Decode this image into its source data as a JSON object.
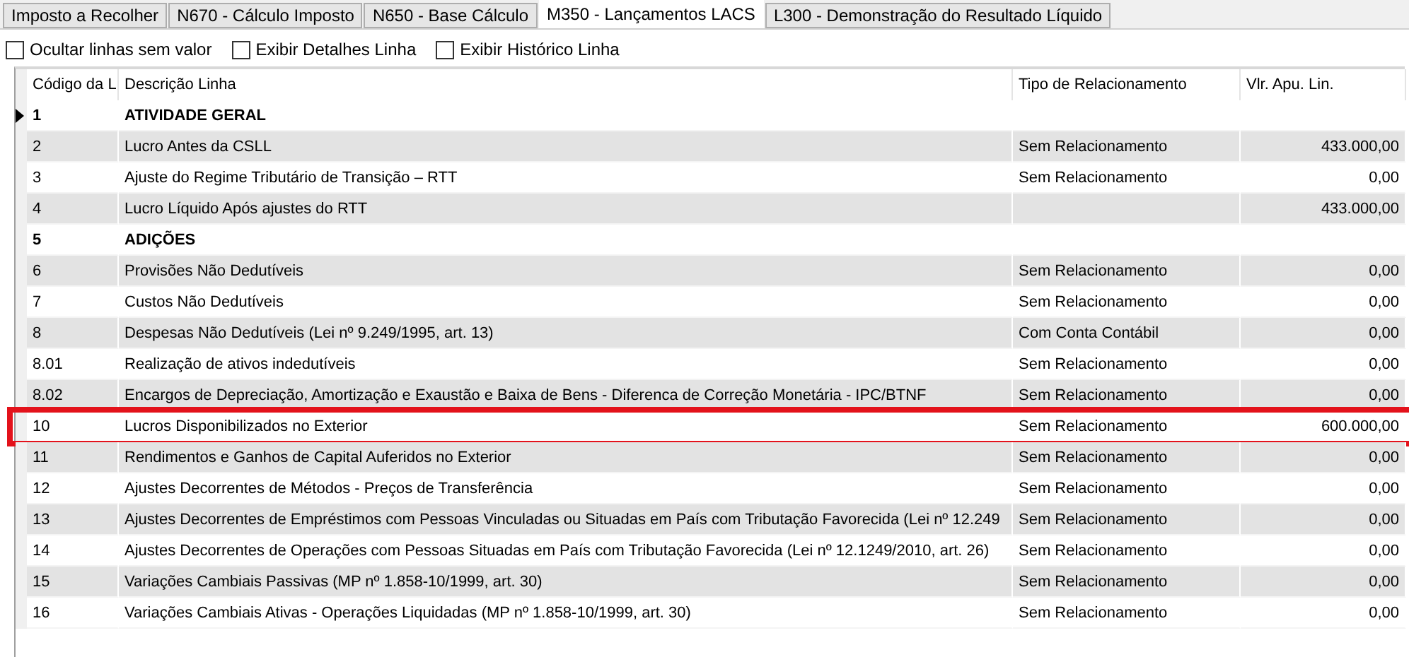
{
  "tabs": [
    {
      "label": "Imposto a Recolher",
      "selected": false
    },
    {
      "label": "N670 - Cálculo Imposto",
      "selected": false
    },
    {
      "label": "N650 - Base Cálculo",
      "selected": false
    },
    {
      "label": "M350 - Lançamentos LACS",
      "selected": true
    },
    {
      "label": "L300 - Demonstração do Resultado Líquido",
      "selected": false
    }
  ],
  "options": [
    {
      "label": "Ocultar linhas sem valor",
      "checked": false
    },
    {
      "label": "Exibir Detalhes Linha",
      "checked": false
    },
    {
      "label": "Exibir Histórico Linha",
      "checked": false
    }
  ],
  "table": {
    "columns": [
      "Código da L",
      "Descrição Linha",
      "Tipo de Relacionamento",
      "Vlr. Apu. Lin."
    ],
    "rows": [
      {
        "kind": "group",
        "current": true,
        "highlighted": false,
        "cells": [
          "1",
          "ATIVIDADE GERAL",
          "",
          ""
        ]
      },
      {
        "kind": "line",
        "current": false,
        "highlighted": false,
        "cells": [
          "2",
          "Lucro Antes da CSLL",
          "Sem Relacionamento",
          "433.000,00"
        ]
      },
      {
        "kind": "line",
        "current": false,
        "highlighted": false,
        "cells": [
          "3",
          "Ajuste do Regime Tributário de Transição – RTT",
          "Sem Relacionamento",
          "0,00"
        ]
      },
      {
        "kind": "line",
        "current": false,
        "highlighted": false,
        "cells": [
          "4",
          "Lucro Líquido Após ajustes do RTT",
          "",
          "433.000,00"
        ]
      },
      {
        "kind": "group",
        "current": false,
        "highlighted": false,
        "cells": [
          "5",
          "ADIÇÕES",
          "",
          ""
        ]
      },
      {
        "kind": "line",
        "current": false,
        "highlighted": false,
        "cells": [
          "6",
          "Provisões Não Dedutíveis",
          "Sem Relacionamento",
          "0,00"
        ]
      },
      {
        "kind": "line",
        "current": false,
        "highlighted": false,
        "cells": [
          "7",
          "Custos Não Dedutíveis",
          "Sem Relacionamento",
          "0,00"
        ]
      },
      {
        "kind": "line",
        "current": false,
        "highlighted": false,
        "cells": [
          "8",
          "Despesas Não Dedutíveis (Lei nº 9.249/1995, art. 13)",
          "Com Conta Contábil",
          "0,00"
        ]
      },
      {
        "kind": "line",
        "current": false,
        "highlighted": false,
        "cells": [
          "8.01",
          "Realização de ativos indedutíveis",
          "Sem Relacionamento",
          "0,00"
        ]
      },
      {
        "kind": "line",
        "current": false,
        "highlighted": false,
        "cells": [
          "8.02",
          "Encargos de Depreciação, Amortização e Exaustão e Baixa de Bens - Diferenca de Correção Monetária - IPC/BTNF",
          "Sem Relacionamento",
          "0,00"
        ]
      },
      {
        "kind": "line",
        "current": false,
        "highlighted": true,
        "cells": [
          "10",
          "Lucros Disponibilizados no Exterior",
          "Sem Relacionamento",
          "600.000,00"
        ]
      },
      {
        "kind": "line",
        "current": false,
        "highlighted": false,
        "cells": [
          "11",
          "Rendimentos e Ganhos de Capital Auferidos no Exterior",
          "Sem Relacionamento",
          "0,00"
        ]
      },
      {
        "kind": "line",
        "current": false,
        "highlighted": false,
        "cells": [
          "12",
          "Ajustes Decorrentes de Métodos - Preços de Transferência",
          "Sem Relacionamento",
          "0,00"
        ]
      },
      {
        "kind": "line",
        "current": false,
        "highlighted": false,
        "cells": [
          "13",
          "Ajustes Decorrentes de Empréstimos com Pessoas Vinculadas ou Situadas em País com Tributação Favorecida (Lei nº 12.249",
          "Sem Relacionamento",
          "0,00"
        ]
      },
      {
        "kind": "line",
        "current": false,
        "highlighted": false,
        "cells": [
          "14",
          "Ajustes Decorrentes de Operações com Pessoas Situadas em País com Tributação Favorecida (Lei nº 12.1249/2010, art. 26)",
          "Sem Relacionamento",
          "0,00"
        ]
      },
      {
        "kind": "line",
        "current": false,
        "highlighted": false,
        "cells": [
          "15",
          "Variações Cambiais Passivas (MP nº 1.858-10/1999, art. 30)",
          "Sem Relacionamento",
          "0,00"
        ]
      },
      {
        "kind": "line",
        "current": false,
        "highlighted": false,
        "cells": [
          "16",
          "Variações Cambiais Ativas - Operações Liquidadas (MP nº 1.858-10/1999, art. 30)",
          "Sem Relacionamento",
          "0,00"
        ]
      }
    ]
  }
}
